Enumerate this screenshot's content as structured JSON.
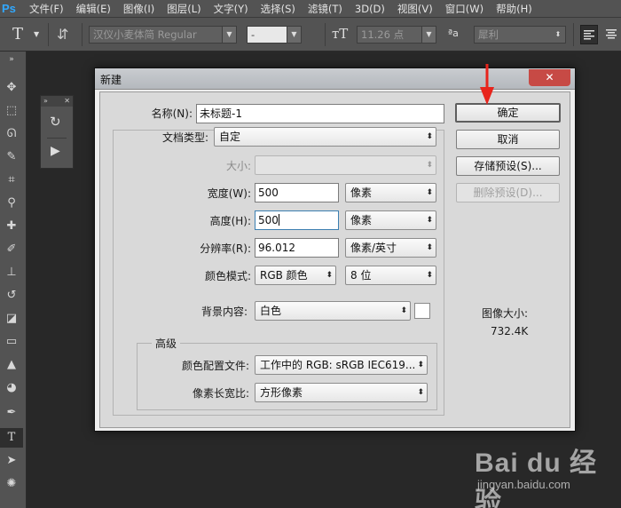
{
  "app": {
    "logo": "Ps"
  },
  "menu": [
    "文件(F)",
    "编辑(E)",
    "图像(I)",
    "图层(L)",
    "文字(Y)",
    "选择(S)",
    "滤镜(T)",
    "3D(D)",
    "视图(V)",
    "窗口(W)",
    "帮助(H)"
  ],
  "options_bar": {
    "font_family": "汉仪小麦体简 Regular",
    "font_style": "-",
    "font_size": "11.26 点",
    "aa_label": "ªa",
    "antialias": "犀利"
  },
  "dialog": {
    "title": "新建",
    "close_glyph": "✕",
    "name_label": "名称(N):",
    "name_value": "未标题-1",
    "doc_type_label": "文档类型:",
    "doc_type_value": "自定",
    "size_label": "大小:",
    "size_value": "",
    "width_label": "宽度(W):",
    "width_value": "500",
    "width_unit": "像素",
    "height_label": "高度(H):",
    "height_value": "500",
    "height_unit": "像素",
    "resolution_label": "分辨率(R):",
    "resolution_value": "96.012",
    "resolution_unit": "像素/英寸",
    "color_mode_label": "颜色模式:",
    "color_mode_value": "RGB 颜色",
    "bit_depth_value": "8 位",
    "background_label": "背景内容:",
    "background_value": "白色",
    "advanced_label": "高级",
    "color_profile_label": "颜色配置文件:",
    "color_profile_value": "工作中的 RGB: sRGB IEC619...",
    "pixel_aspect_label": "像素长宽比:",
    "pixel_aspect_value": "方形像素",
    "buttons": {
      "ok": "确定",
      "cancel": "取消",
      "save_preset": "存储预设(S)...",
      "delete_preset": "删除预设(D)..."
    },
    "image_size_label": "图像大小:",
    "image_size_value": "732.4K"
  },
  "watermark": {
    "brand": "Bai du 经验",
    "url": "jingyan.baidu.com"
  },
  "colors": {
    "accent_arrow": "#e8241c",
    "close_button": "#c74a45"
  }
}
